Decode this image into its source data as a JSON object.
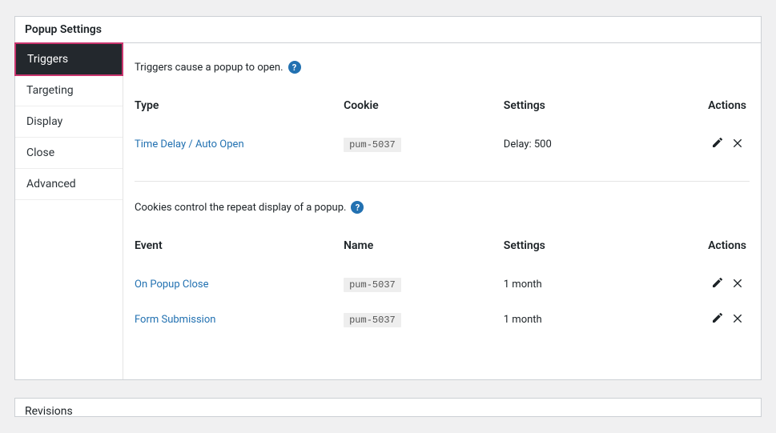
{
  "panel": {
    "title": "Popup Settings"
  },
  "tabs": {
    "items": [
      {
        "label": "Triggers"
      },
      {
        "label": "Targeting"
      },
      {
        "label": "Display"
      },
      {
        "label": "Close"
      },
      {
        "label": "Advanced"
      }
    ]
  },
  "triggers": {
    "desc": "Triggers cause a popup to open.",
    "headers": {
      "type": "Type",
      "cookie": "Cookie",
      "settings": "Settings",
      "actions": "Actions"
    },
    "rows": [
      {
        "type": "Time Delay / Auto Open",
        "cookie": "pum-5037",
        "settings": "Delay: 500"
      }
    ]
  },
  "cookies": {
    "desc": "Cookies control the repeat display of a popup.",
    "headers": {
      "event": "Event",
      "name": "Name",
      "settings": "Settings",
      "actions": "Actions"
    },
    "rows": [
      {
        "event": "On Popup Close",
        "name": "pum-5037",
        "settings": "1 month"
      },
      {
        "event": "Form Submission",
        "name": "pum-5037",
        "settings": "1 month"
      }
    ]
  },
  "second_panel": {
    "title": "Revisions"
  }
}
